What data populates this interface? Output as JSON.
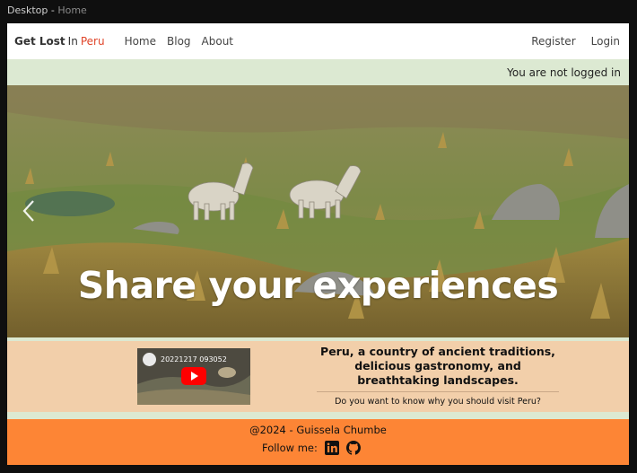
{
  "window": {
    "title_prefix": "Desktop - ",
    "title_page": "Home"
  },
  "navbar": {
    "brand": {
      "part1": "Get Lost",
      "part2": "In",
      "part3": "Peru"
    },
    "links": [
      "Home",
      "Blog",
      "About"
    ],
    "auth": {
      "register": "Register",
      "login": "Login"
    }
  },
  "status": {
    "text": "You are not logged in"
  },
  "hero": {
    "title": "Share your experiences"
  },
  "info": {
    "video_title": "20221217 093052",
    "headline": "Peru, a country of ancient traditions, delicious gastronomy, and breathtaking landscapes.",
    "question": "Do you want to know why you should visit Peru?"
  },
  "footer": {
    "copyright": "@2024 - Guissela Chumbe",
    "follow_label": "Follow me:",
    "icons": [
      "linkedin-icon",
      "github-icon"
    ]
  },
  "colors": {
    "brand_accent": "#e0452a",
    "status_bg": "#dce9d2",
    "info_bg": "#f2cfaa",
    "footer_bg": "#fd8535"
  }
}
